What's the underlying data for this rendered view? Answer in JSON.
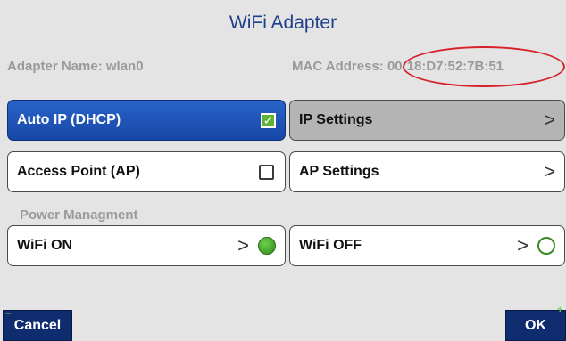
{
  "header": {
    "title": "WiFi Adapter"
  },
  "info": {
    "adapter_name": "Adapter Name: wlan0",
    "mac_address": "MAC Address: 00:18:D7:52:7B:51"
  },
  "buttons": {
    "auto_ip": "Auto IP (DHCP)",
    "ip_settings": "IP Settings",
    "access_point": "Access Point (AP)",
    "ap_settings": "AP Settings",
    "wifi_on": "WiFi ON",
    "wifi_off": "WiFi OFF"
  },
  "section": {
    "power_label": "Power Managment"
  },
  "glyphs": {
    "chevron": ">",
    "check": "✓"
  },
  "footer": {
    "cancel": "Cancel",
    "ok": "OK",
    "cancel_corner": "–",
    "ok_corner": "+"
  },
  "state": {
    "auto_ip_checked": true,
    "access_point_checked": false,
    "wifi_on_active": true,
    "wifi_off_active": false
  },
  "colors": {
    "primary_blue": "#1e4fb3",
    "highlight_ring": "#d6202a",
    "led_green": "#3aa52a"
  }
}
